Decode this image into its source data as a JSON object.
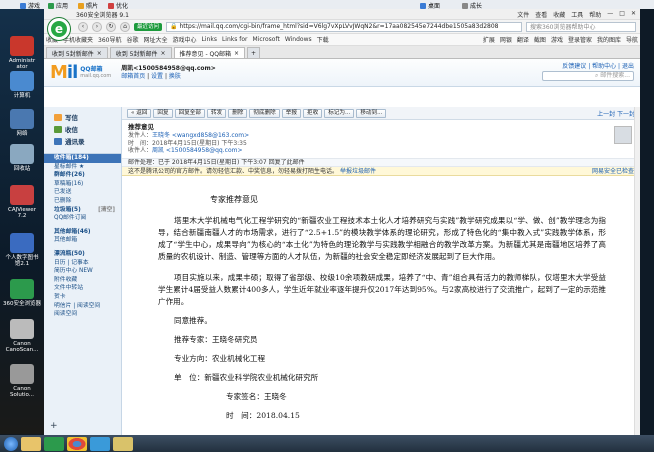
{
  "top_bar": {
    "left_items": [
      "游戏",
      "应用",
      "照片",
      "优化"
    ],
    "right_items": [
      "桌面",
      "成长"
    ]
  },
  "desktop_icons": [
    {
      "label": "Administr ator",
      "color": "#c9372c"
    },
    {
      "label": "计算机",
      "color": "#4a8ad0"
    },
    {
      "label": "网络",
      "color": "#4a78b0"
    },
    {
      "label": "回收站",
      "color": "#8aa8c0"
    },
    {
      "label": "CAJViewer 7.2",
      "color": "#c84040"
    },
    {
      "label": "个人数字图书馆2.1",
      "color": "#3a6bc0"
    },
    {
      "label": "360安全浏览器",
      "color": "#2c9a4c"
    },
    {
      "label": "Canon CanoScan...",
      "color": "#bbbbbb"
    },
    {
      "label": "Canon Solutio...",
      "color": "#999999"
    }
  ],
  "browser": {
    "title": "360安全浏览器 9.1",
    "top_menus": [
      "文件",
      "查看",
      "收藏",
      "工具",
      "帮助"
    ],
    "badge": "最近访问",
    "address": "https://mail.qq.com/cgi-bin/frame_html?sid=V6lg7vXpLVvJWqN2&r=17aa082545e7244dbe1505a83d2808",
    "search_placeholder": "搜索360浏览器帮助中心",
    "bookmarks": [
      "收藏",
      "手机收藏夹",
      "360导航",
      "谷歌",
      "网址大全",
      "游戏中心",
      "Links",
      "Links for",
      "Microsoft",
      "Windows",
      "下载"
    ],
    "bookmarks_right": [
      "扩展",
      "网银",
      "翻译",
      "截图",
      "游戏",
      "登录管家",
      "我的图库",
      "导航"
    ],
    "tabs": [
      {
        "label": "收到 5封新邮件",
        "active": false
      },
      {
        "label": "收到 5封新邮件",
        "active": false
      },
      {
        "label": "推荐意见 - QQ邮箱",
        "active": true
      }
    ]
  },
  "qqmail": {
    "logo": "M",
    "logo_rest": "il",
    "logo_sub": "QQ邮箱",
    "logo_domain": "mail.qq.com",
    "account": "周凯<1500584958@qq.com>",
    "links": [
      "邮箱首页",
      "设置",
      "换肤"
    ],
    "right_links": [
      "反馈建议",
      "帮助中心",
      "退出"
    ],
    "search_placeholder": "邮件搜索..."
  },
  "sidebar": {
    "buttons": [
      {
        "label": "写信",
        "color": "#f2a03a"
      },
      {
        "label": "收信",
        "color": "#5a9a3a"
      },
      {
        "label": "通讯录",
        "color": "#3d74b8"
      }
    ],
    "folders": [
      {
        "label": "收件箱(184)",
        "extra": "",
        "sel": true,
        "bold": true
      },
      {
        "label": "星标邮件 ★",
        "extra": "",
        "sel": false,
        "bold": false
      },
      {
        "label": "群邮件(26)",
        "extra": "",
        "sel": false,
        "bold": true
      },
      {
        "label": "草稿箱(16)",
        "extra": "",
        "sel": false,
        "bold": false
      },
      {
        "label": "已发送",
        "extra": "",
        "sel": false,
        "bold": false
      },
      {
        "label": "已删除",
        "extra": "",
        "sel": false,
        "bold": false
      },
      {
        "label": "垃圾箱(5)",
        "extra": "[清空]",
        "sel": false,
        "bold": true
      },
      {
        "label": "QQ邮件订阅",
        "extra": "",
        "sel": false,
        "bold": false
      },
      {
        "label": "",
        "extra": "",
        "sel": false,
        "bold": false
      },
      {
        "label": "其他邮箱(46)",
        "extra": "",
        "sel": false,
        "bold": true
      },
      {
        "label": "其他邮箱",
        "extra": "",
        "sel": false,
        "bold": false
      },
      {
        "label": "",
        "extra": "",
        "sel": false,
        "bold": false
      },
      {
        "label": "漂流瓶(50)",
        "extra": "",
        "sel": false,
        "bold": true
      },
      {
        "label": "日历 | 记事本",
        "extra": "",
        "sel": false,
        "bold": false
      },
      {
        "label": "简历中心 NEW",
        "extra": "",
        "sel": false,
        "bold": false
      },
      {
        "label": "附件收藏",
        "extra": "",
        "sel": false,
        "bold": false
      },
      {
        "label": "文件中转站",
        "extra": "",
        "sel": false,
        "bold": false
      },
      {
        "label": "贺卡",
        "extra": "",
        "sel": false,
        "bold": false
      },
      {
        "label": "明信片 | 阅读空间",
        "extra": "",
        "sel": false,
        "bold": false
      },
      {
        "label": "阅读空间",
        "extra": "",
        "sel": false,
        "bold": false
      }
    ]
  },
  "toolbar": {
    "buttons": [
      "« 返回",
      "回复",
      "回复全部",
      "转发",
      "删除",
      "彻底删除",
      "举报",
      "拒收",
      "标记为...",
      "移动到..."
    ],
    "pager": "上一封 下一封"
  },
  "mail": {
    "subject": "推荐意见",
    "from_label": "发件人：",
    "from": "王晓冬 <wangxd858@163.com>",
    "time_label": "时　间：",
    "time": "2018年4月15日(星期日) 下午3:35",
    "to_label": "收件人：",
    "to": "周凯 <1500584958@qq.com>",
    "notice": "邮件处理：已于 2018年4月15日(星期日) 下午3:07 回复了此邮件",
    "warn": "这不是腾讯公司的官方邮件。请勿轻信汇款、中奖信息，勿轻易拨打陌生电话。",
    "warn_link": "举报垃圾邮件",
    "warn_right": "网易安全已检查",
    "title": "专家推荐意见",
    "p1": "塔里木大学机械电气化工程学研究的“新疆农业工程技术本土化人才培养研究与实践”教学研究成果以“学、做、创”教学理念为指导，结合新疆南疆人才的市场需求，进行了“2.5+1.5”的模块教学体系的理论研究，形成了特色化的“集中教入式”实践教学体系，形成了“学生中心，成果导向”为核心的“本土化”为特色的理论教学与实践教学相融合的教学改革方案。为新疆尤其是南疆地区培养了高质量的农机设计、制造、管理等方面的人才队伍，为新疆的社会安全稳定即经济发展起到了巨大作用。",
    "p2": "项目实施以来，成果丰硕；取得了省部级、校级10余项教研成果，培养了“中、青”组合具有活力的教师梯队，仅塔里木大学受益学生累计4届受益人数累计400多人，学生近年就业率逐年提升仅2017年达到95%。与2家高校进行了交流推广，起到了一定的示范推广作用。",
    "l1": "同意推荐。",
    "l2": "推荐专家：王晓冬研究员",
    "l3": "专业方向：农业机械化工程",
    "l4": "单　位：新疆农业科学院农业机械化研究所",
    "l5": "专家签名：王晓冬",
    "l6": "时　间：2018.04.15"
  },
  "taskbar": {
    "apps": [
      "start",
      "folder",
      "browser360",
      "chrome",
      "wps",
      "qqmail"
    ]
  }
}
